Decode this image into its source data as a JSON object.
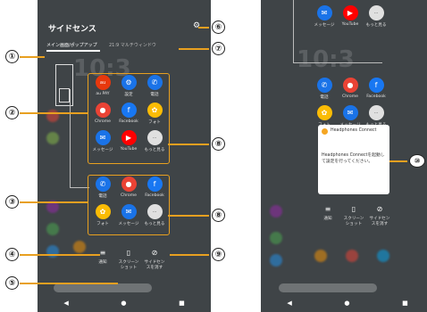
{
  "left": {
    "title": "サイドセンス",
    "tabs": [
      "メイン画面/ポップアップ",
      "21:9 マルチウィンドウ"
    ],
    "apps": [
      {
        "label": "au PAY",
        "icon": "au-pay-icon",
        "color": "#e8380d",
        "glyph": "au"
      },
      {
        "label": "設定",
        "icon": "settings-icon",
        "color": "#1a73e8",
        "glyph": "⚙"
      },
      {
        "label": "電話",
        "icon": "phone-icon",
        "color": "#1a73e8",
        "glyph": "✆"
      },
      {
        "label": "Chrome",
        "icon": "chrome-icon",
        "color": "#ea4335",
        "glyph": "●"
      },
      {
        "label": "Facebook",
        "icon": "facebook-icon",
        "color": "#1877f2",
        "glyph": "f"
      },
      {
        "label": "フォト",
        "icon": "photos-icon",
        "color": "#fbbc05",
        "glyph": "✿"
      },
      {
        "label": "メッセージ",
        "icon": "messages-icon",
        "color": "#1a73e8",
        "glyph": "✉"
      },
      {
        "label": "YouTube",
        "icon": "youtube-icon",
        "color": "#ff0000",
        "glyph": "▶"
      },
      {
        "label": "もっと見る",
        "icon": "more-icon",
        "color": "#e0e0e0",
        "glyph": "···"
      }
    ],
    "multi_apps": [
      {
        "label": "電話",
        "icon": "phone-icon",
        "color": "#1a73e8",
        "glyph": "✆"
      },
      {
        "label": "Chrome",
        "icon": "chrome-icon",
        "color": "#ea4335",
        "glyph": "●"
      },
      {
        "label": "Facebook",
        "icon": "facebook-icon",
        "color": "#1877f2",
        "glyph": "f"
      },
      {
        "label": "フォト",
        "icon": "photos-icon",
        "color": "#fbbc05",
        "glyph": "✿"
      },
      {
        "label": "メッセージ",
        "icon": "messages-icon",
        "color": "#1a73e8",
        "glyph": "✉"
      },
      {
        "label": "もっと見る",
        "icon": "more-icon",
        "color": "#e0e0e0",
        "glyph": "···"
      }
    ],
    "actions": [
      {
        "label": "通知",
        "icon": "notification-icon",
        "glyph": "≡"
      },
      {
        "label": "スクリーン\nショット",
        "icon": "screenshot-icon",
        "glyph": "▯"
      },
      {
        "label": "サイドセン\nスを消す",
        "icon": "dismiss-icon",
        "glyph": "⊘"
      }
    ]
  },
  "right": {
    "apps": [
      {
        "label": "メッセージ",
        "icon": "messages-icon",
        "color": "#1a73e8",
        "glyph": "✉"
      },
      {
        "label": "YouTube",
        "icon": "youtube-icon",
        "color": "#ff0000",
        "glyph": "▶"
      },
      {
        "label": "もっと見る",
        "icon": "more-icon",
        "color": "#e0e0e0",
        "glyph": "···"
      },
      {
        "label": "電話",
        "icon": "phone-icon",
        "color": "#1a73e8",
        "glyph": "✆"
      },
      {
        "label": "Chrome",
        "icon": "chrome-icon",
        "color": "#ea4335",
        "glyph": "●"
      },
      {
        "label": "Facebook",
        "icon": "facebook-icon",
        "color": "#1877f2",
        "glyph": "f"
      },
      {
        "label": "フォト",
        "icon": "photos-icon",
        "color": "#fbbc05",
        "glyph": "✿"
      },
      {
        "label": "メッセージ",
        "icon": "messages-icon",
        "color": "#1a73e8",
        "glyph": "✉"
      },
      {
        "label": "もっと見る",
        "icon": "more-icon",
        "color": "#e0e0e0",
        "glyph": "···"
      }
    ],
    "notification": {
      "app": "Headphones Connect",
      "body": "Headphones Connectを起動して設定を行ってください。"
    },
    "actions": [
      {
        "label": "通知",
        "icon": "notification-icon",
        "glyph": "≡"
      },
      {
        "label": "スクリーン\nショット",
        "icon": "screenshot-icon",
        "glyph": "▯"
      },
      {
        "label": "サイドセン\nスを消す",
        "icon": "dismiss-icon",
        "glyph": "⊘"
      }
    ]
  },
  "callouts": [
    "①",
    "②",
    "③",
    "④",
    "⑤",
    "⑥",
    "⑦",
    "⑧",
    "⑧",
    "⑨",
    "⑩"
  ],
  "nav": {
    "back": "◀",
    "home": "●",
    "recent": "■"
  },
  "clock_ghost": "10:3"
}
